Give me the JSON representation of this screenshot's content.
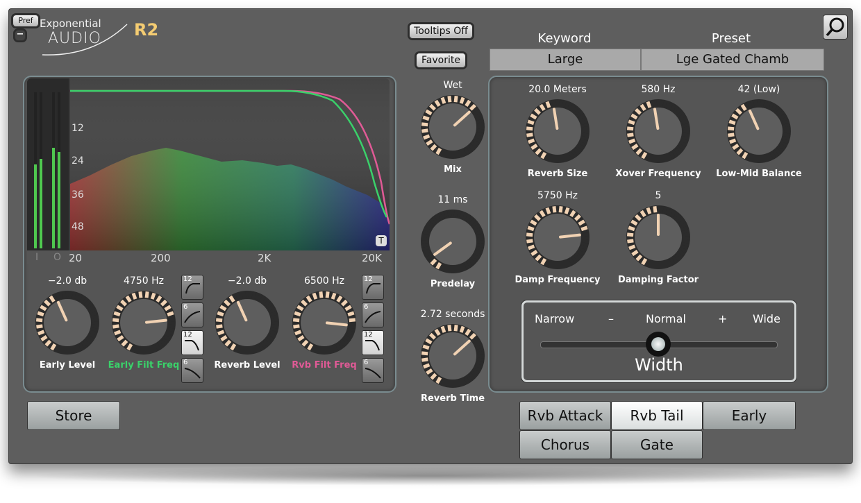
{
  "header": {
    "pref_label": "Pref",
    "minus_label": "−",
    "brand_line1": "Exponential",
    "brand_line2": "AUDIO",
    "product": "R2",
    "search_icon": "magnifier-icon"
  },
  "top_buttons": {
    "tooltips": "Tooltips Off",
    "favorite": "Favorite"
  },
  "preset_bar": {
    "keyword_header": "Keyword",
    "preset_header": "Preset",
    "keyword_value": "Large",
    "preset_value": "Lge Gated Chamb"
  },
  "meters": {
    "in_label": "I",
    "out_label": "O"
  },
  "spectrum": {
    "db_ticks": [
      "12",
      "24",
      "36",
      "48"
    ],
    "freq_ticks": [
      "20",
      "200",
      "2K",
      "20K"
    ],
    "t_label": "T",
    "colors": {
      "early_curve": "#3ad16a",
      "rvb_curve": "#e05a96"
    }
  },
  "left_controls": [
    {
      "value": "−2.0 db",
      "label": "Early Level",
      "level": 0.42
    },
    {
      "value": "4750 Hz",
      "label": "Early Filt Freq",
      "level": 0.78,
      "color": "#3ad16a"
    },
    {
      "value": "−2.0 db",
      "label": "Reverb Level",
      "level": 0.42
    },
    {
      "value": "6500 Hz",
      "label": "Rvb Filt Freq",
      "level": 0.82,
      "color": "#e05a96"
    }
  ],
  "slope_buttons_left": [
    "12",
    "6",
    "12",
    "6"
  ],
  "slope_buttons_right": [
    "12",
    "6",
    "12",
    "6"
  ],
  "center_controls": [
    {
      "top": "Wet",
      "value": "",
      "label": "Mix",
      "level": 0.66
    },
    {
      "top": "11 ms",
      "label": "Predelay",
      "level": 0.08
    },
    {
      "top": "2.72 seconds",
      "label": "Reverb Time",
      "level": 0.66
    }
  ],
  "right_controls": [
    {
      "value": "20.0 Meters",
      "label": "Reverb Size",
      "level": 0.47
    },
    {
      "value": "580 Hz",
      "label": "Xover Frequency",
      "level": 0.47
    },
    {
      "value": "42 (Low)",
      "label": "Low-Mid Balance",
      "level": 0.42
    },
    {
      "value": "5750 Hz",
      "label": "Damp Frequency",
      "level": 0.78
    },
    {
      "value": "5",
      "label": "Damping Factor",
      "level": 0.5
    }
  ],
  "width": {
    "narrow": "Narrow",
    "minus": "–",
    "normal": "Normal",
    "plus": "+",
    "wide": "Wide",
    "title": "Width",
    "position": 0.5
  },
  "store_label": "Store",
  "tabs": [
    {
      "label": "Rvb Attack",
      "active": false
    },
    {
      "label": "Rvb Tail",
      "active": true
    },
    {
      "label": "Early",
      "active": false
    },
    {
      "label": "Chorus",
      "active": false
    },
    {
      "label": "Gate",
      "active": false
    }
  ]
}
